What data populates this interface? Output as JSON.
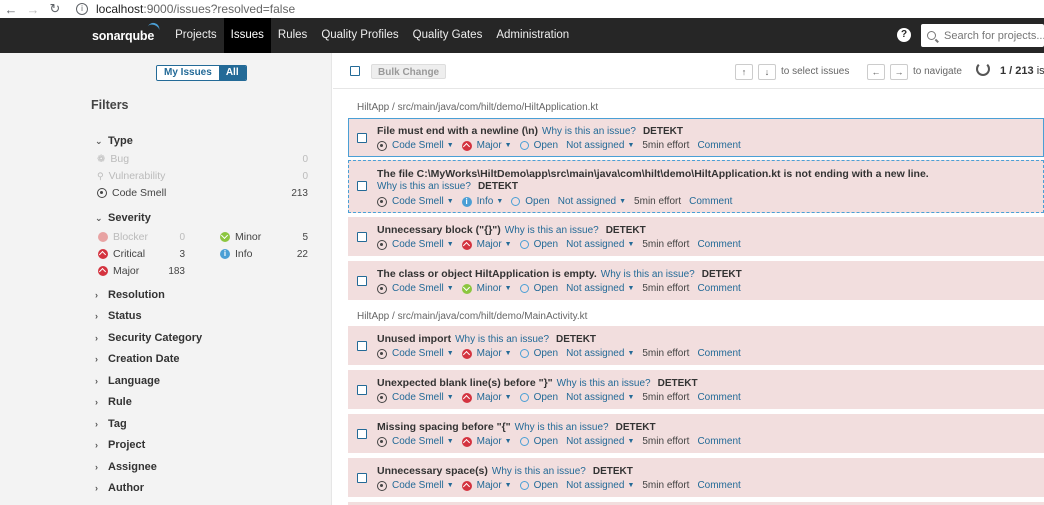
{
  "browser": {
    "back": "←",
    "forward": "→",
    "reload": "↻",
    "url_host": "localhost",
    "url_rest": ":9000/issues?resolved=false"
  },
  "topnav": {
    "logo": "sonarqube",
    "items": [
      "Projects",
      "Issues",
      "Rules",
      "Quality Profiles",
      "Quality Gates",
      "Administration"
    ],
    "active": "Issues",
    "help": "?",
    "search_placeholder": "Search for projects..."
  },
  "sidebar": {
    "toggle": {
      "my_issues": "My Issues",
      "all": "All"
    },
    "filters_title": "Filters",
    "type": {
      "label": "Type",
      "items": [
        {
          "label": "Bug",
          "count": "0"
        },
        {
          "label": "Vulnerability",
          "count": "0"
        },
        {
          "label": "Code Smell",
          "count": "213"
        }
      ]
    },
    "severity": {
      "label": "Severity",
      "items": [
        {
          "label": "Blocker",
          "count": "0"
        },
        {
          "label": "Minor",
          "count": "5"
        },
        {
          "label": "Critical",
          "count": "3"
        },
        {
          "label": "Info",
          "count": "22"
        },
        {
          "label": "Major",
          "count": "183"
        }
      ]
    },
    "collapsed_facets": [
      "Resolution",
      "Status",
      "Security Category",
      "Creation Date",
      "Language",
      "Rule",
      "Tag",
      "Project",
      "Assignee",
      "Author"
    ]
  },
  "toolbar": {
    "bulk_change": "Bulk Change",
    "up": "↑",
    "down": "↓",
    "select_hint": "to select issues",
    "left": "←",
    "right": "→",
    "navigate_hint": "to navigate",
    "counter_current": "1",
    "counter_sep": " / ",
    "counter_total": "213",
    "counter_suffix": " issues"
  },
  "groups": [
    {
      "path": "HiltApp  /  src/main/java/com/hilt/demo/HiltApplication.kt"
    },
    {
      "path": "HiltApp  /  src/main/java/com/hilt/demo/MainActivity.kt"
    }
  ],
  "issues": [
    {
      "title": "File must end with a newline (\\n)",
      "why": "Why is this an issue?",
      "tag": "DETEKT",
      "type": "Code Smell",
      "severity": "Major",
      "status": "Open",
      "assignee": "Not assigned",
      "effort": "5min effort",
      "comment": "Comment"
    },
    {
      "title": "The file C:\\MyWorks\\HiltDemo\\app\\src\\main\\java\\com\\hilt\\demo\\HiltApplication.kt is not ending with a new line.",
      "why": "Why is this an issue?",
      "tag": "DETEKT",
      "type": "Code Smell",
      "severity": "Info",
      "status": "Open",
      "assignee": "Not assigned",
      "effort": "5min effort",
      "comment": "Comment"
    },
    {
      "title": "Unnecessary block (\"{}\")",
      "why": "Why is this an issue?",
      "tag": "DETEKT",
      "type": "Code Smell",
      "severity": "Major",
      "status": "Open",
      "assignee": "Not assigned",
      "effort": "5min effort",
      "comment": "Comment"
    },
    {
      "title": "The class or object HiltApplication is empty.",
      "why": "Why is this an issue?",
      "tag": "DETEKT",
      "type": "Code Smell",
      "severity": "Minor",
      "status": "Open",
      "assignee": "Not assigned",
      "effort": "5min effort",
      "comment": "Comment"
    },
    {
      "title": "Unused import",
      "why": "Why is this an issue?",
      "tag": "DETEKT",
      "type": "Code Smell",
      "severity": "Major",
      "status": "Open",
      "assignee": "Not assigned",
      "effort": "5min effort",
      "comment": "Comment"
    },
    {
      "title": "Unexpected blank line(s) before \"}\"",
      "why": "Why is this an issue?",
      "tag": "DETEKT",
      "type": "Code Smell",
      "severity": "Major",
      "status": "Open",
      "assignee": "Not assigned",
      "effort": "5min effort",
      "comment": "Comment"
    },
    {
      "title": "Missing spacing before \"{\"",
      "why": "Why is this an issue?",
      "tag": "DETEKT",
      "type": "Code Smell",
      "severity": "Major",
      "status": "Open",
      "assignee": "Not assigned",
      "effort": "5min effort",
      "comment": "Comment"
    },
    {
      "title": "Unnecessary space(s)",
      "why": "Why is this an issue?",
      "tag": "DETEKT",
      "type": "Code Smell",
      "severity": "Major",
      "status": "Open",
      "assignee": "Not assigned",
      "effort": "5min effort",
      "comment": "Comment"
    }
  ]
}
